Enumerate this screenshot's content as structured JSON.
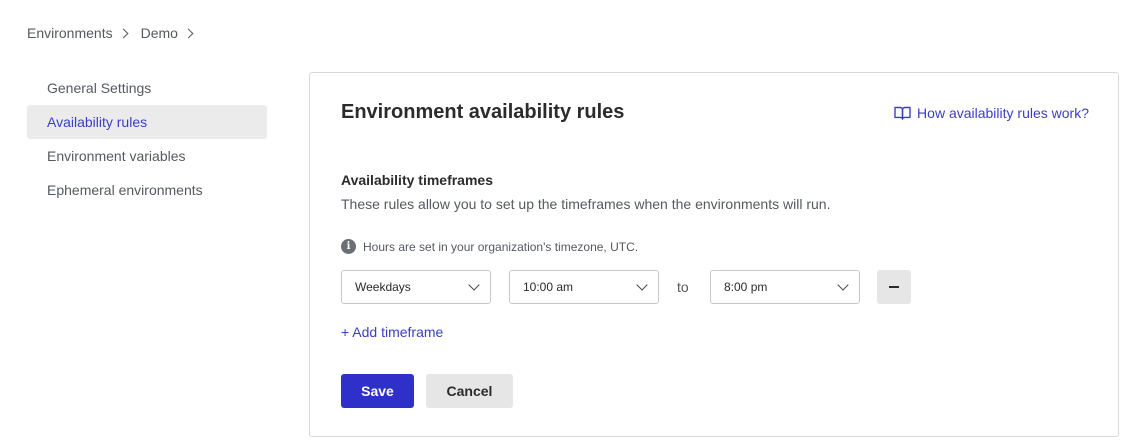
{
  "breadcrumb": {
    "items": [
      "Environments",
      "Demo"
    ]
  },
  "sidebar": {
    "items": [
      {
        "label": "General Settings",
        "active": false
      },
      {
        "label": "Availability rules",
        "active": true
      },
      {
        "label": "Environment variables",
        "active": false
      },
      {
        "label": "Ephemeral environments",
        "active": false
      }
    ]
  },
  "card": {
    "title": "Environment availability rules",
    "help_link": "How availability rules work?",
    "help_icon": "book-icon",
    "section_title": "Availability timeframes",
    "section_desc": "These rules allow you to set up the timeframes when the environments will run.",
    "info_text": "Hours are set in your organization's timezone, UTC.",
    "info_icon": "info-icon"
  },
  "timeframe": {
    "days": "Weekdays",
    "start": "10:00 am",
    "to_label": "to",
    "end": "8:00 pm",
    "remove_icon": "minus-icon"
  },
  "actions": {
    "add_timeframe": "+ Add timeframe",
    "save": "Save",
    "cancel": "Cancel"
  },
  "colors": {
    "accent": "#3b3ec4",
    "primary_button": "#2f30c9",
    "active_bg": "#ebebeb"
  }
}
